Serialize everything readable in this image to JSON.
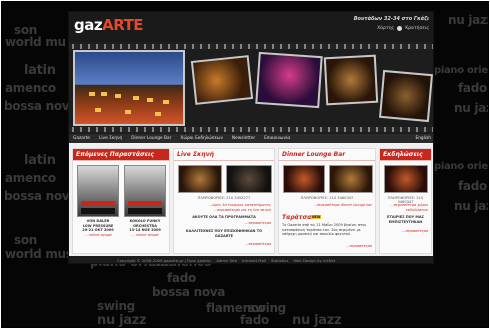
{
  "background_words": [
    {
      "text": "son",
      "size": 12
    },
    {
      "text": "world mu",
      "size": 12
    },
    {
      "text": "latin",
      "size": 13
    },
    {
      "text": "amenco",
      "size": 12
    },
    {
      "text": "bossa nova",
      "size": 12
    },
    {
      "text": "latin",
      "size": 13
    },
    {
      "text": "amenco",
      "size": 12
    },
    {
      "text": "bossa nova",
      "size": 12
    },
    {
      "text": "son",
      "size": 12
    },
    {
      "text": "world music",
      "size": 12
    },
    {
      "text": "piano oriental",
      "size": 12
    },
    {
      "text": "flamenco",
      "size": 12
    },
    {
      "text": "fado",
      "size": 12
    },
    {
      "text": "bossa nova",
      "size": 12
    },
    {
      "text": "swing",
      "size": 12
    },
    {
      "text": "nu jazz",
      "size": 13
    },
    {
      "text": "nu jazz",
      "size": 12
    },
    {
      "text": "piano oriental",
      "size": 10
    },
    {
      "text": "fado",
      "size": 12
    },
    {
      "text": "nu jazz",
      "size": 12
    },
    {
      "text": "piano oriental",
      "size": 10
    },
    {
      "text": "fado",
      "size": 12
    },
    {
      "text": "nu jazz",
      "size": 12
    },
    {
      "text": "flamenco",
      "size": 12
    },
    {
      "text": "fado",
      "size": 12
    },
    {
      "text": "swing",
      "size": 12
    },
    {
      "text": "nu jazz",
      "size": 13
    }
  ],
  "header": {
    "logo_main": "gaz",
    "logo_accent": "ARTE",
    "address": "Βουτάδων 32-34 στο Γκάζι",
    "map_link": "Χάρτης",
    "reservations": "Κρατήσεις"
  },
  "nav": [
    "Gazarte",
    "Live Σκηνή",
    "Dinner Lounge Bar",
    "Χώροι Εκδηλώσεων",
    "Newsletter",
    "Επικοινωνία"
  ],
  "nav_lang": "English",
  "columns": {
    "events": {
      "title": "Επόμενες Παραστάσεις",
      "items": [
        {
          "line1": "VON DALER",
          "line2": "LOW PRESSURE",
          "line3": "20-21 OKT 2009",
          "link": "... online αγορά"
        },
        {
          "line1": "KOKOLO FUNKY",
          "line2": "ORCHESTRA",
          "line3": "13-14 NOE 2009",
          "link": "... online αγορά"
        }
      ]
    },
    "live": {
      "title": "Live Σκηνή",
      "phone": "ΠΛΗΡΟΦΟΡΙΕΣ: 210 3452277",
      "link1": "...ώρες λειτουργίας καταστήματος",
      "link2": "...περισσότερα για τη live σκηνή",
      "headline1": "ΑΚΟΥΤΕ ΟΛΑ ΤΑ ΠΡΟΓΡΑΜΜΑΤΑ",
      "link3": "...περισσότερα",
      "headline2": "ΚΑΛΛΙΤΕΧΝΕΣ ΠΟΥ ΕΠΙΣΚΕΦΘΗΚΑΝ ΤΟ GAZARTE",
      "link4": "...περισσότερα"
    },
    "dinner": {
      "title": "Dinner Lounge Bar",
      "phone": "ΠΛΗΡΟΦΟΡΙΕΣ: 210 3460347",
      "link1": "...περισσότερα dinner lounge bar",
      "taratsa": "Ταράτσα",
      "new_badge": "NEW",
      "text": "Το Gazarte από τις 21 Μαΐου 2009 βγαίνει στην καταπράσινη ταράτσα του. Σας περιμένει με υπέροχη μουσική και ποικιλία φαγητού.",
      "link2": "...περισσότερα"
    },
    "venues": {
      "title": "Εκδηλώσεις",
      "phone": "ΠΛΗΡΟΦΟΡΙΕΣ: 210 3460347",
      "link1": "...περισσότερα χώροι εκδηλώσεων",
      "headline": "ΕΤΑΙΡΙΕΣ ΠΟΥ ΜΑΣ ΕΜΠΙΣΤΕΥΤΗΚΑΝ",
      "link2": "...περισσότερα"
    }
  },
  "footer": [
    "Copyright © 2008-2009 gazarte.gr | Όροι χρήσης",
    "Admin Site",
    "Intranet Mail",
    "Statistics",
    "Web Design by ArtNet"
  ]
}
